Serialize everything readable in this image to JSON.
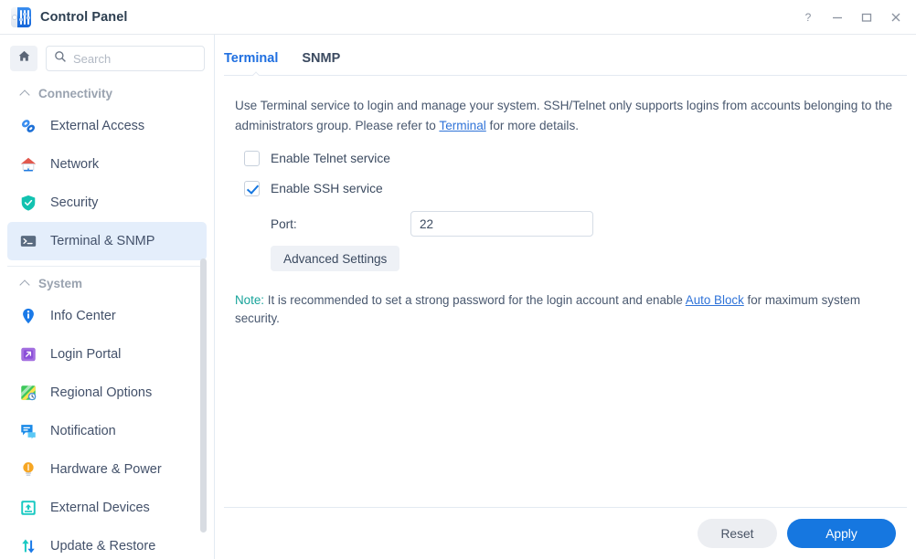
{
  "window": {
    "title": "Control Panel",
    "app_icon": "control-panel-icon",
    "controls": {
      "help": "?",
      "minimize": "—",
      "maximize": "□",
      "close": "✕"
    }
  },
  "sidebar": {
    "home_button_icon": "home-icon",
    "search": {
      "placeholder": "Search",
      "value": "",
      "icon": "search-icon"
    },
    "groups": [
      {
        "label": "Connectivity",
        "expanded": true,
        "items": [
          {
            "label": "External Access",
            "icon": "link-icon",
            "active": false
          },
          {
            "label": "Network",
            "icon": "house-network-icon",
            "active": false
          },
          {
            "label": "Security",
            "icon": "shield-check-icon",
            "active": false
          },
          {
            "label": "Terminal & SNMP",
            "icon": "terminal-prompt-icon",
            "active": true
          }
        ]
      },
      {
        "label": "System",
        "expanded": true,
        "items": [
          {
            "label": "Info Center",
            "icon": "info-pin-icon",
            "active": false
          },
          {
            "label": "Login Portal",
            "icon": "external-arrow-icon",
            "active": false
          },
          {
            "label": "Regional Options",
            "icon": "globe-clock-icon",
            "active": false
          },
          {
            "label": "Notification",
            "icon": "speech-bubble-icon",
            "active": false
          },
          {
            "label": "Hardware & Power",
            "icon": "lightbulb-icon",
            "active": false
          },
          {
            "label": "External Devices",
            "icon": "usb-eject-icon",
            "active": false
          },
          {
            "label": "Update & Restore",
            "icon": "update-arrows-icon",
            "active": false
          }
        ]
      }
    ]
  },
  "main": {
    "tabs": [
      {
        "label": "Terminal",
        "active": true
      },
      {
        "label": "SNMP",
        "active": false
      }
    ],
    "description": {
      "part1": "Use Terminal service to login and manage your system. SSH/Telnet only supports logins from accounts belonging to the administrators group. Please refer to ",
      "link": "Terminal",
      "part2": " for more details."
    },
    "telnet": {
      "label": "Enable Telnet service",
      "checked": false
    },
    "ssh": {
      "label": "Enable SSH service",
      "checked": true
    },
    "port": {
      "label": "Port:",
      "value": "22"
    },
    "advanced_settings_label": "Advanced Settings",
    "note": {
      "keyword": "Note:",
      "part1": " It is recommended to set a strong password for the login account and enable ",
      "link": "Auto Block",
      "part2": " for maximum system security."
    }
  },
  "footer": {
    "reset_label": "Reset",
    "apply_label": "Apply"
  },
  "colors": {
    "accent": "#1677e0",
    "active_tab": "#1f6fe0",
    "note_keyword": "#16a39a",
    "link": "#2f73d8",
    "active_nav_bg": "#e4eefb"
  }
}
